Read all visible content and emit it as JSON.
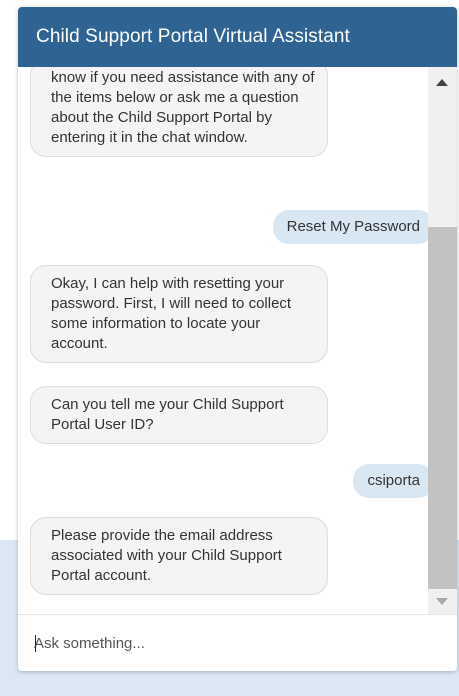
{
  "header": {
    "title": "Child Support Portal Virtual Assistant"
  },
  "messages": [
    {
      "from": "bot",
      "text": "know if you need assistance with any of the items below or ask me a question about the Child Support Portal by entering it in the chat window."
    },
    {
      "from": "user",
      "text": "Reset My Password"
    },
    {
      "from": "bot",
      "text": "Okay, I can help with resetting your password. First, I will need to collect some information to locate your account."
    },
    {
      "from": "bot",
      "text": "Can you tell me your Child Support Portal User ID?"
    },
    {
      "from": "user",
      "text": "csiporta"
    },
    {
      "from": "bot",
      "text": "Please provide the email address associated with your Child Support Portal account."
    }
  ],
  "input": {
    "placeholder": "Ask something...",
    "value": ""
  },
  "colors": {
    "header_bg": "#2f6392",
    "bot_bubble_bg": "#f4f4f4",
    "user_bubble_bg": "#d9e7f3",
    "page_band_bg": "#dbe8f3"
  }
}
